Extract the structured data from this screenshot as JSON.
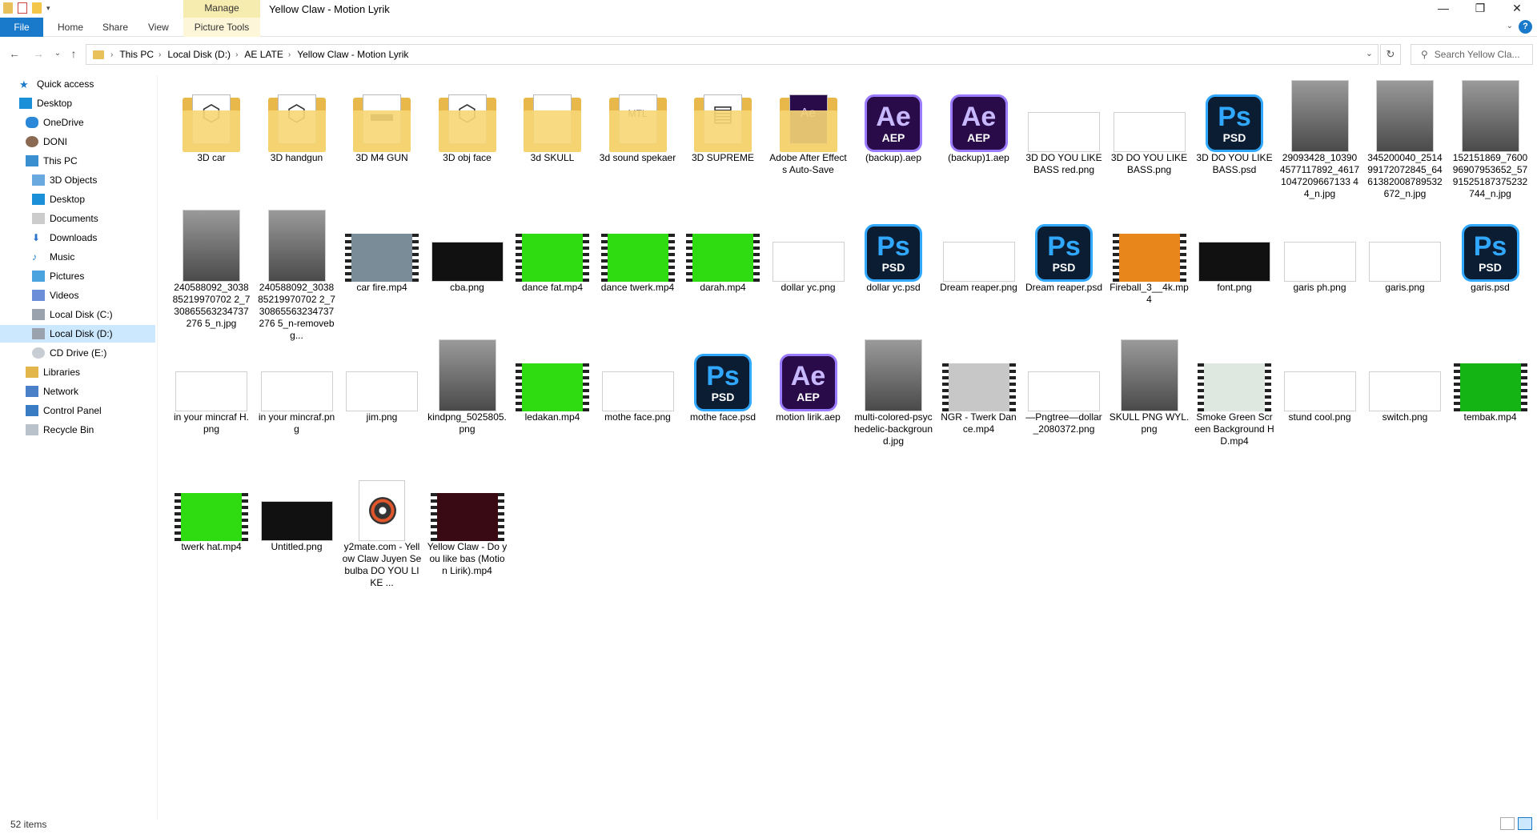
{
  "window": {
    "title": "Yellow Claw - Motion Lyrik",
    "manage_tab": "Manage",
    "minimize": "—",
    "maximize": "❐",
    "close": "✕"
  },
  "ribbon": {
    "tabs": [
      "File",
      "Home",
      "Share",
      "View",
      "Picture Tools"
    ],
    "help": "?"
  },
  "address": {
    "crumbs": [
      "This PC",
      "Local Disk (D:)",
      "AE LATE",
      "Yellow Claw - Motion Lyrik"
    ],
    "separator": "›",
    "search_placeholder": "Search Yellow Cla..."
  },
  "sidebar": {
    "items": [
      {
        "label": "Quick access",
        "icon": "star-icon"
      },
      {
        "label": "Desktop",
        "icon": "desktop-icon"
      },
      {
        "label": "OneDrive",
        "icon": "cloud-icon"
      },
      {
        "label": "DONI",
        "icon": "user-icon"
      },
      {
        "label": "This PC",
        "icon": "computer-icon"
      },
      {
        "label": "3D Objects",
        "icon": "cube-icon"
      },
      {
        "label": "Desktop",
        "icon": "desktop-icon"
      },
      {
        "label": "Documents",
        "icon": "documents-icon"
      },
      {
        "label": "Downloads",
        "icon": "download-icon"
      },
      {
        "label": "Music",
        "icon": "music-icon"
      },
      {
        "label": "Pictures",
        "icon": "pictures-icon"
      },
      {
        "label": "Videos",
        "icon": "video-icon"
      },
      {
        "label": "Local Disk (C:)",
        "icon": "drive-icon"
      },
      {
        "label": "Local Disk (D:)",
        "icon": "drive-icon"
      },
      {
        "label": "CD Drive (E:)",
        "icon": "cd-icon"
      },
      {
        "label": "Libraries",
        "icon": "library-icon"
      },
      {
        "label": "Network",
        "icon": "network-icon"
      },
      {
        "label": "Control Panel",
        "icon": "control-panel-icon"
      },
      {
        "label": "Recycle Bin",
        "icon": "recycle-bin-icon"
      }
    ]
  },
  "files": [
    {
      "name": "3D car",
      "kind": "folder"
    },
    {
      "name": "3D handgun",
      "kind": "folder"
    },
    {
      "name": "3D M4 GUN",
      "kind": "folder"
    },
    {
      "name": "3D obj face",
      "kind": "folder"
    },
    {
      "name": "3d SKULL",
      "kind": "folder"
    },
    {
      "name": "3d sound spekaer",
      "kind": "folder"
    },
    {
      "name": "3D SUPREME",
      "kind": "folder"
    },
    {
      "name": "Adobe After Effects Auto-Save",
      "kind": "folder"
    },
    {
      "name": "(backup).aep",
      "kind": "ae"
    },
    {
      "name": "(backup)1.aep",
      "kind": "ae"
    },
    {
      "name": "3D DO YOU LIKE BASS red.png",
      "kind": "image"
    },
    {
      "name": "3D DO YOU LIKE BASS.png",
      "kind": "image"
    },
    {
      "name": "3D DO YOU LIKE BASS.psd",
      "kind": "ps"
    },
    {
      "name": "29093428_103904577117892_46171047209667133 44_n.jpg",
      "kind": "photo"
    },
    {
      "name": "345200040_251499172072845_6461382008789532672_n.jpg",
      "kind": "photo"
    },
    {
      "name": "152151869_760096907953652_5791525187375232744_n.jpg",
      "kind": "photo"
    },
    {
      "name": "240588092_303885219970702 2_730865563234737276 5_n.jpg",
      "kind": "photo"
    },
    {
      "name": "240588092_303885219970702 2_730865563234737276 5_n-removebg...",
      "kind": "photo"
    },
    {
      "name": "car fire.mp4",
      "kind": "video",
      "color": "#7a8c98"
    },
    {
      "name": "cba.png",
      "kind": "dark-image"
    },
    {
      "name": "dance fat.mp4",
      "kind": "video",
      "color": "#2fdc12"
    },
    {
      "name": "dance twerk.mp4",
      "kind": "video",
      "color": "#2fdc12"
    },
    {
      "name": "darah.mp4",
      "kind": "video",
      "color": "#2fdc12"
    },
    {
      "name": "dollar yc.png",
      "kind": "image"
    },
    {
      "name": "dollar yc.psd",
      "kind": "ps"
    },
    {
      "name": "Dream reaper.png",
      "kind": "image"
    },
    {
      "name": "Dream reaper.psd",
      "kind": "ps"
    },
    {
      "name": "Fireball_3__4k.mp4",
      "kind": "video",
      "color": "#e8861c"
    },
    {
      "name": "font.png",
      "kind": "dark-image"
    },
    {
      "name": "garis ph.png",
      "kind": "image"
    },
    {
      "name": "garis.png",
      "kind": "image"
    },
    {
      "name": "garis.psd",
      "kind": "ps"
    },
    {
      "name": "in your mincraf H.png",
      "kind": "image"
    },
    {
      "name": "in your mincraf.png",
      "kind": "image"
    },
    {
      "name": "jim.png",
      "kind": "image"
    },
    {
      "name": "kindpng_5025805.png",
      "kind": "photo"
    },
    {
      "name": "ledakan.mp4",
      "kind": "video",
      "color": "#2fdc12"
    },
    {
      "name": "mothe face.png",
      "kind": "image"
    },
    {
      "name": "mothe face.psd",
      "kind": "ps"
    },
    {
      "name": "motion lirik.aep",
      "kind": "ae"
    },
    {
      "name": "multi-colored-psychedelic-background.jpg",
      "kind": "photo"
    },
    {
      "name": "NGR - Twerk Dance.mp4",
      "kind": "video",
      "color": "#c7c7c7"
    },
    {
      "name": "—Pngtree—dollar_2080372.png",
      "kind": "image"
    },
    {
      "name": "SKULL PNG WYL.png",
      "kind": "photo"
    },
    {
      "name": "Smoke Green Screen Background HD.mp4",
      "kind": "video",
      "color": "#dfe8e0"
    },
    {
      "name": "stund cool.png",
      "kind": "image"
    },
    {
      "name": "switch.png",
      "kind": "image"
    },
    {
      "name": "tembak.mp4",
      "kind": "video",
      "color": "#14b414"
    },
    {
      "name": "twerk hat.mp4",
      "kind": "video",
      "color": "#2fdc12"
    },
    {
      "name": "Untitled.png",
      "kind": "dark-image"
    },
    {
      "name": "y2mate.com - Yellow Claw Juyen Sebulba DO YOU LIKE ...",
      "kind": "audio"
    },
    {
      "name": "Yellow Claw - Do you like bas (Motion Lirik).mp4",
      "kind": "video",
      "color": "#3a0a14"
    }
  ],
  "file_labels": {
    "ae_big": "Ae",
    "ae_small": "AEP",
    "ps_big": "Ps",
    "ps_small": "PSD",
    "folder_badge_ae": "Ae",
    "folder_badge_aep": "AEP",
    "folder_badge_mtl": "MTL"
  },
  "status": {
    "count": "52 items"
  },
  "colors": {
    "accent": "#1979ca",
    "selection": "#cce8ff",
    "manage": "#f7ecb0"
  }
}
